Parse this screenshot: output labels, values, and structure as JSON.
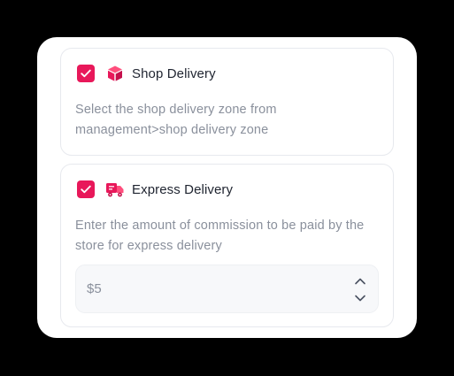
{
  "delivery_options": {
    "shop": {
      "checked": true,
      "icon": "box-icon",
      "title": "Shop Delivery",
      "description": "Select the shop delivery zone from management>shop delivery zone"
    },
    "express": {
      "checked": true,
      "icon": "delivery-truck-icon",
      "title": "Express Delivery",
      "description": "Enter the amount of commission to be paid by the store for express delivery",
      "amount_value": "$5"
    }
  },
  "colors": {
    "accent": "#e8185a",
    "text_primary": "#1f2430",
    "text_muted": "#8a909c",
    "border": "#e7e9ee",
    "input_bg": "#f7f8fa"
  }
}
